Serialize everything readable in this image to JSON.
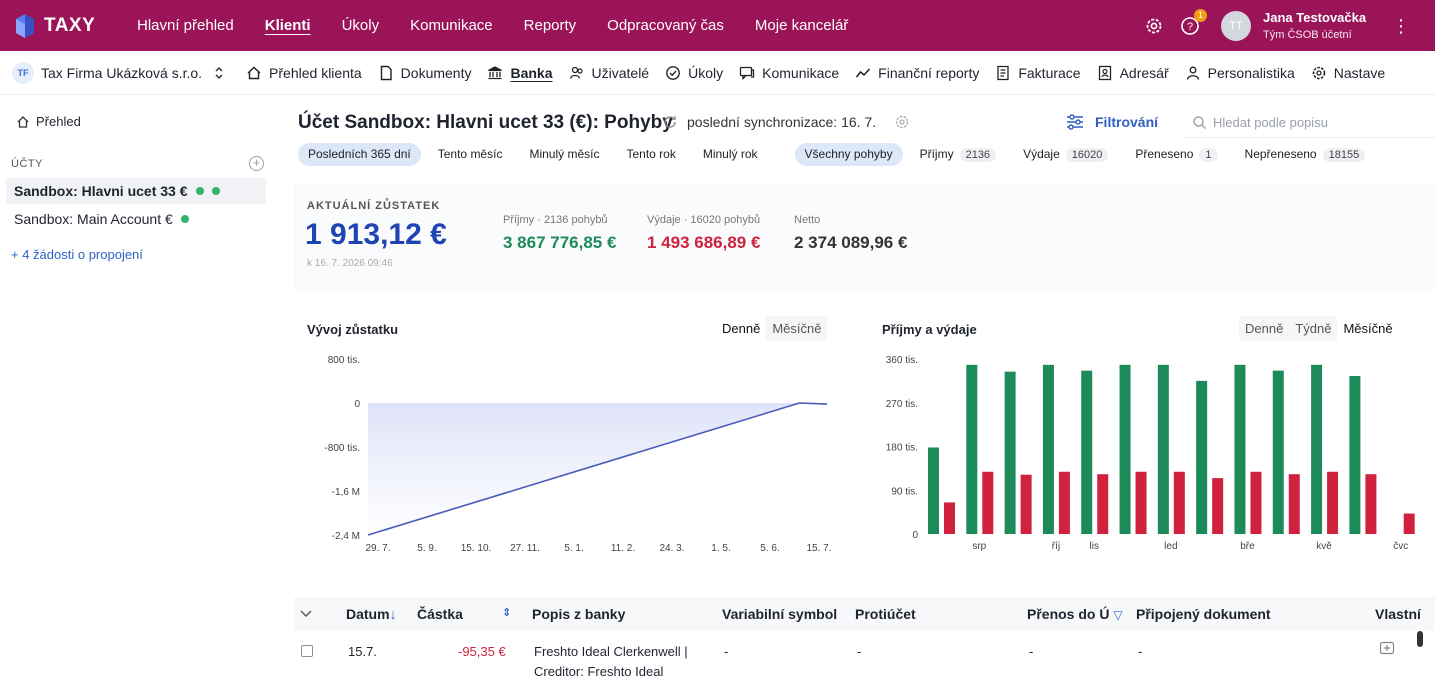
{
  "brand": {
    "name": "TAXY",
    "color": "#9b1458"
  },
  "top_nav": [
    {
      "label": "Hlavní přehled"
    },
    {
      "label": "Klienti",
      "active": true
    },
    {
      "label": "Úkoly"
    },
    {
      "label": "Komunikace"
    },
    {
      "label": "Reporty"
    },
    {
      "label": "Odpracovaný čas"
    },
    {
      "label": "Moje kancelář"
    }
  ],
  "user": {
    "initials": "TT",
    "name": "Jana Testovačka",
    "team": "Tým ČSOB účetní",
    "notifications": "1"
  },
  "client": {
    "badge": "TF",
    "name": "Tax Firma Ukázková s.r.o."
  },
  "sub_nav": [
    {
      "label": "Přehled klienta",
      "icon": "home-icon"
    },
    {
      "label": "Dokumenty",
      "icon": "document-icon"
    },
    {
      "label": "Banka",
      "icon": "bank-icon",
      "active": true
    },
    {
      "label": "Uživatelé",
      "icon": "users-icon"
    },
    {
      "label": "Úkoly",
      "icon": "check-icon"
    },
    {
      "label": "Komunikace",
      "icon": "chat-icon"
    },
    {
      "label": "Finanční reporty",
      "icon": "chart-icon"
    },
    {
      "label": "Fakturace",
      "icon": "invoice-icon"
    },
    {
      "label": "Adresář",
      "icon": "address-book-icon"
    },
    {
      "label": "Personalistika",
      "icon": "person-icon"
    },
    {
      "label": "Nastave",
      "icon": "gear-icon"
    }
  ],
  "sidebar": {
    "overview": "Přehled",
    "accounts_heading": "ÚČTY",
    "accounts": [
      {
        "label": "Sandbox: Hlavni ucet 33 €",
        "selected": true
      },
      {
        "label": "Sandbox: Main Account €"
      }
    ],
    "connect_link": "+ 4 žádosti o propojení"
  },
  "header": {
    "title": "Účet Sandbox: Hlavni ucet 33 (€): Pohyby",
    "sync": "poslední synchronizace: 16. 7.",
    "filter_label": "Filtrování",
    "search_placeholder": "Hledat podle popisu"
  },
  "period_filters": [
    {
      "label": "Posledních 365 dní",
      "active": true
    },
    {
      "label": "Tento měsíc"
    },
    {
      "label": "Minulý měsíc"
    },
    {
      "label": "Tento rok"
    },
    {
      "label": "Minulý rok"
    }
  ],
  "type_filters": [
    {
      "label": "Všechny pohyby",
      "active": true,
      "count": ""
    },
    {
      "label": "Příjmy",
      "count": "2136"
    },
    {
      "label": "Výdaje",
      "count": "16020"
    },
    {
      "label": "Přeneseno",
      "count": "1"
    },
    {
      "label": "Nepřeneseno",
      "count": "18155"
    }
  ],
  "balance": {
    "heading": "AKTUÁLNÍ ZŮSTATEK",
    "value": "1 913,12 €",
    "timestamp": "k 16. 7. 2026 09:46",
    "income_label": "Příjmy · 2136 pohybů",
    "income_value": "3 867 776,85 €",
    "expense_label": "Výdaje · 16020 pohybů",
    "expense_value": "1 493 686,89 €",
    "net_label": "Netto",
    "net_value": "2 374 089,96 €",
    "colors": {
      "income": "#1d8a5a",
      "expense": "#d0213f",
      "balance": "#1f44b3"
    }
  },
  "charts": {
    "balance_title": "Vývoj zůstatku",
    "balance_toggle": [
      "Denně",
      "Měsíčně"
    ],
    "flow_title": "Příjmy a výdaje",
    "flow_toggle": [
      "Denně",
      "Týdně",
      "Měsíčně"
    ]
  },
  "chart_data": [
    {
      "type": "area",
      "title": "Vývoj zůstatku",
      "y_ticks": [
        "800 tis.",
        "0",
        "-800 tis.",
        "-1,6 M",
        "-2,4 M"
      ],
      "ylim": [
        -2400000,
        800000
      ],
      "x_ticks": [
        "29. 7.",
        "5. 9.",
        "15. 10.",
        "27. 11.",
        "5. 1.",
        "11. 2.",
        "24. 3.",
        "1. 5.",
        "5. 6.",
        "15. 7."
      ],
      "points": [
        [
          0,
          -2400000
        ],
        [
          0.94,
          0
        ],
        [
          1,
          -20000
        ]
      ],
      "color": "#4a5ab8"
    },
    {
      "type": "bar",
      "title": "Příjmy a výdaje",
      "y_ticks": [
        "360 tis.",
        "270 tis.",
        "180 tis.",
        "90 tis.",
        "0"
      ],
      "ylim": [
        0,
        360000
      ],
      "categories": [
        "čvc",
        "srp",
        "zář",
        "říj",
        "lis",
        "pro",
        "led",
        "úno",
        "bře",
        "dub",
        "kvě",
        "čvn",
        "čvc"
      ],
      "x_labels": [
        "",
        "srp",
        "",
        "říj",
        "lis",
        "",
        "led",
        "",
        "bře",
        "",
        "kvě",
        "",
        "čvc"
      ],
      "series": [
        {
          "name": "Příjmy",
          "color": "#1d8a5a",
          "values": [
            178000,
            348000,
            334000,
            348000,
            336000,
            348000,
            348000,
            315000,
            348000,
            336000,
            348000,
            325000,
            0
          ]
        },
        {
          "name": "Výdaje",
          "color": "#d0213f",
          "values": [
            65000,
            128000,
            122000,
            128000,
            123000,
            128000,
            128000,
            115000,
            128000,
            123000,
            128000,
            123000,
            42000
          ]
        }
      ]
    }
  ],
  "table": {
    "columns": [
      "Datum",
      "Částka",
      "Popis z banky",
      "Variabilní symbol",
      "Protiúčet",
      "Přenos do Ú",
      "Připojený dokument",
      "Vlastní"
    ],
    "rows": [
      {
        "date": "15.7.",
        "amount": "-95,35 €",
        "description": "Freshto Ideal Clerkenwell |",
        "description2": "Creditor: Freshto Ideal",
        "vs": "-",
        "counter": "-",
        "transfer": "-",
        "document": "-"
      }
    ]
  }
}
